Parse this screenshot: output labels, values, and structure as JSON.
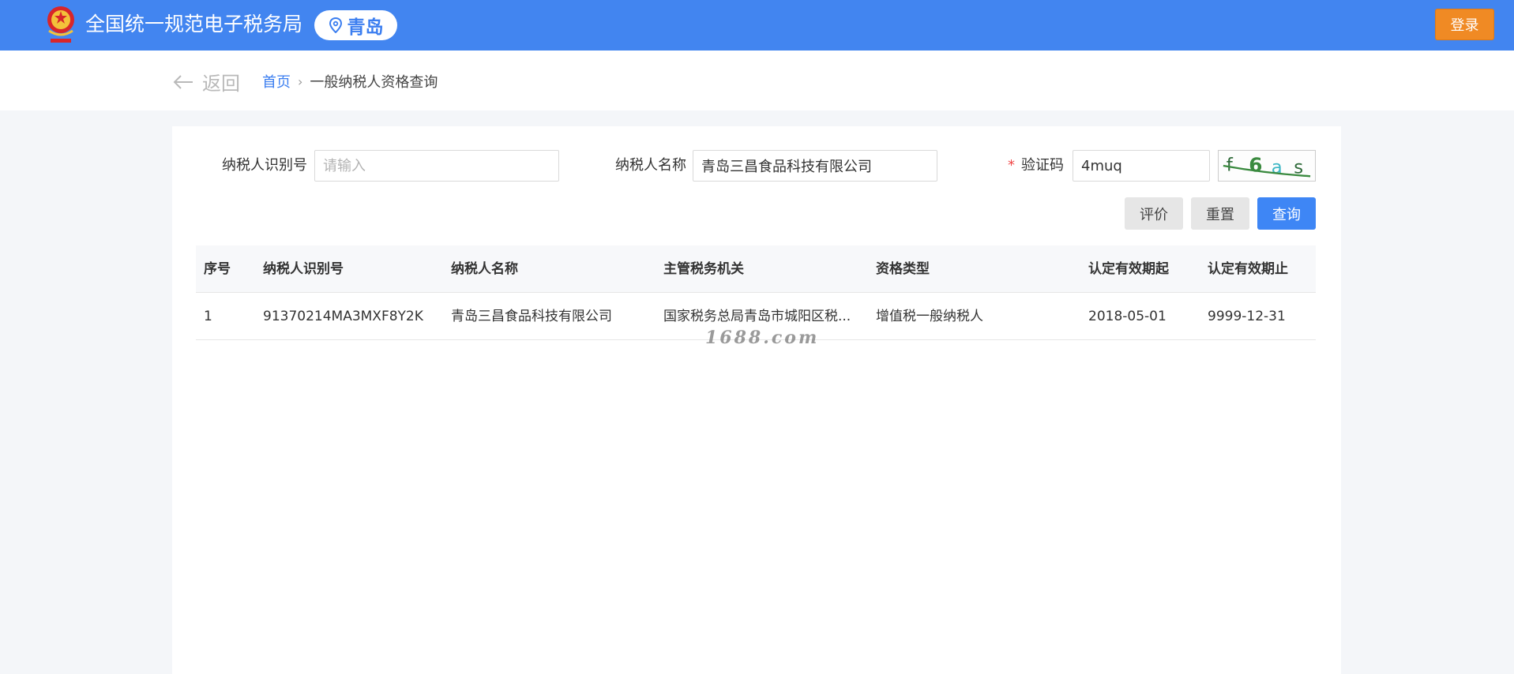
{
  "header": {
    "site_title": "全国统一规范电子税务局",
    "city": "青岛",
    "login_label": "登录",
    "brand_color": "#4285f0",
    "login_color": "#f08a24"
  },
  "nav": {
    "back_label": "返回",
    "breadcrumb_home": "首页",
    "breadcrumb_separator": "›",
    "breadcrumb_current": "一般纳税人资格查询"
  },
  "form": {
    "taxpayer_id_label": "纳税人识别号",
    "taxpayer_id_placeholder": "请输入",
    "taxpayer_id_value": "",
    "taxpayer_name_label": "纳税人名称",
    "taxpayer_name_value": "青岛三昌食品科技有限公司",
    "captcha_required_mark": "*",
    "captcha_label": "验证码",
    "captcha_value": "4muq",
    "captcha_image_text": "f6as"
  },
  "buttons": {
    "evaluate": "评价",
    "reset": "重置",
    "query": "查询"
  },
  "table": {
    "headers": [
      "序号",
      "纳税人识别号",
      "纳税人名称",
      "主管税务机关",
      "资格类型",
      "认定有效期起",
      "认定有效期止"
    ],
    "rows": [
      [
        "1",
        "91370214MA3MXF8Y2K",
        "青岛三昌食品科技有限公司",
        "国家税务总局青岛市城阳区税...",
        "增值税一般纳税人",
        "2018-05-01",
        "9999-12-31"
      ]
    ]
  },
  "watermark": "1688.com"
}
